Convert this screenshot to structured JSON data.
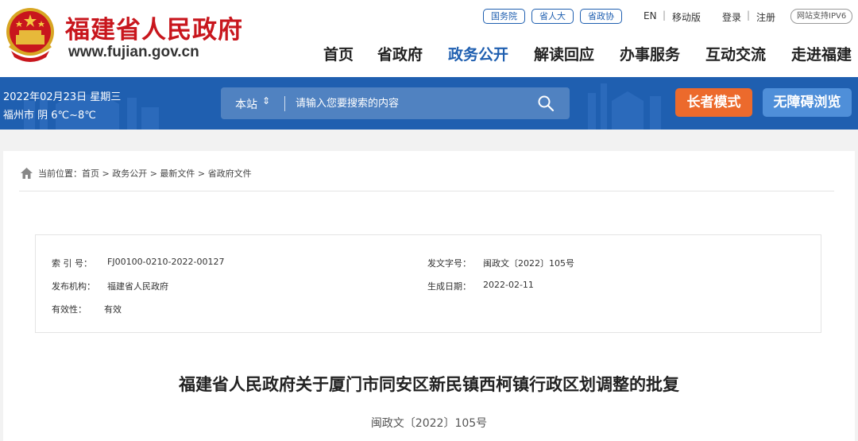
{
  "header": {
    "site_title": "福建省人民政府",
    "site_url": "www.fujian.gov.cn",
    "top_links": [
      "国务院",
      "省人大",
      "省政协"
    ],
    "lang_link": "EN",
    "mobile_link": "移动版",
    "login_link": "登录",
    "register_link": "注册",
    "ipv6_badge": "网站支持IPV6",
    "nav": [
      {
        "label": "首页",
        "active": false
      },
      {
        "label": "省政府",
        "active": false
      },
      {
        "label": "政务公开",
        "active": true
      },
      {
        "label": "解读回应",
        "active": false
      },
      {
        "label": "办事服务",
        "active": false
      },
      {
        "label": "互动交流",
        "active": false
      },
      {
        "label": "走进福建",
        "active": false
      }
    ]
  },
  "banner": {
    "date": "2022年02月23日 星期三",
    "weather": "福州市 阴 6℃~8℃",
    "search_scope": "本站",
    "search_placeholder": "请输入您要搜索的内容",
    "elder_mode_button": "长者模式",
    "accessibility_button": "无障碍浏览"
  },
  "breadcrumb": "当前位置：首页 > 政务公开 > 最新文件 > 省政府文件",
  "meta": {
    "index_label": "索 引 号：",
    "index_value": "FJ00100-0210-2022-00127",
    "issuer_label": "发布机构：",
    "issuer_value": "福建省人民政府",
    "validity_label": "有效性：",
    "validity_value": "有效",
    "docno_label": "发文字号：",
    "docno_value": "闽政文〔2022〕105号",
    "date_label": "生成日期：",
    "date_value": "2022-02-11"
  },
  "document": {
    "title": "福建省人民政府关于厦门市同安区新民镇西柯镇行政区划调整的批复",
    "number": "闽政文〔2022〕105号"
  },
  "colors": {
    "brand_red": "#c8161d",
    "brand_blue": "#1f5fb0",
    "elder_orange": "#ec6a2c",
    "access_blue": "#4f8fd9"
  }
}
